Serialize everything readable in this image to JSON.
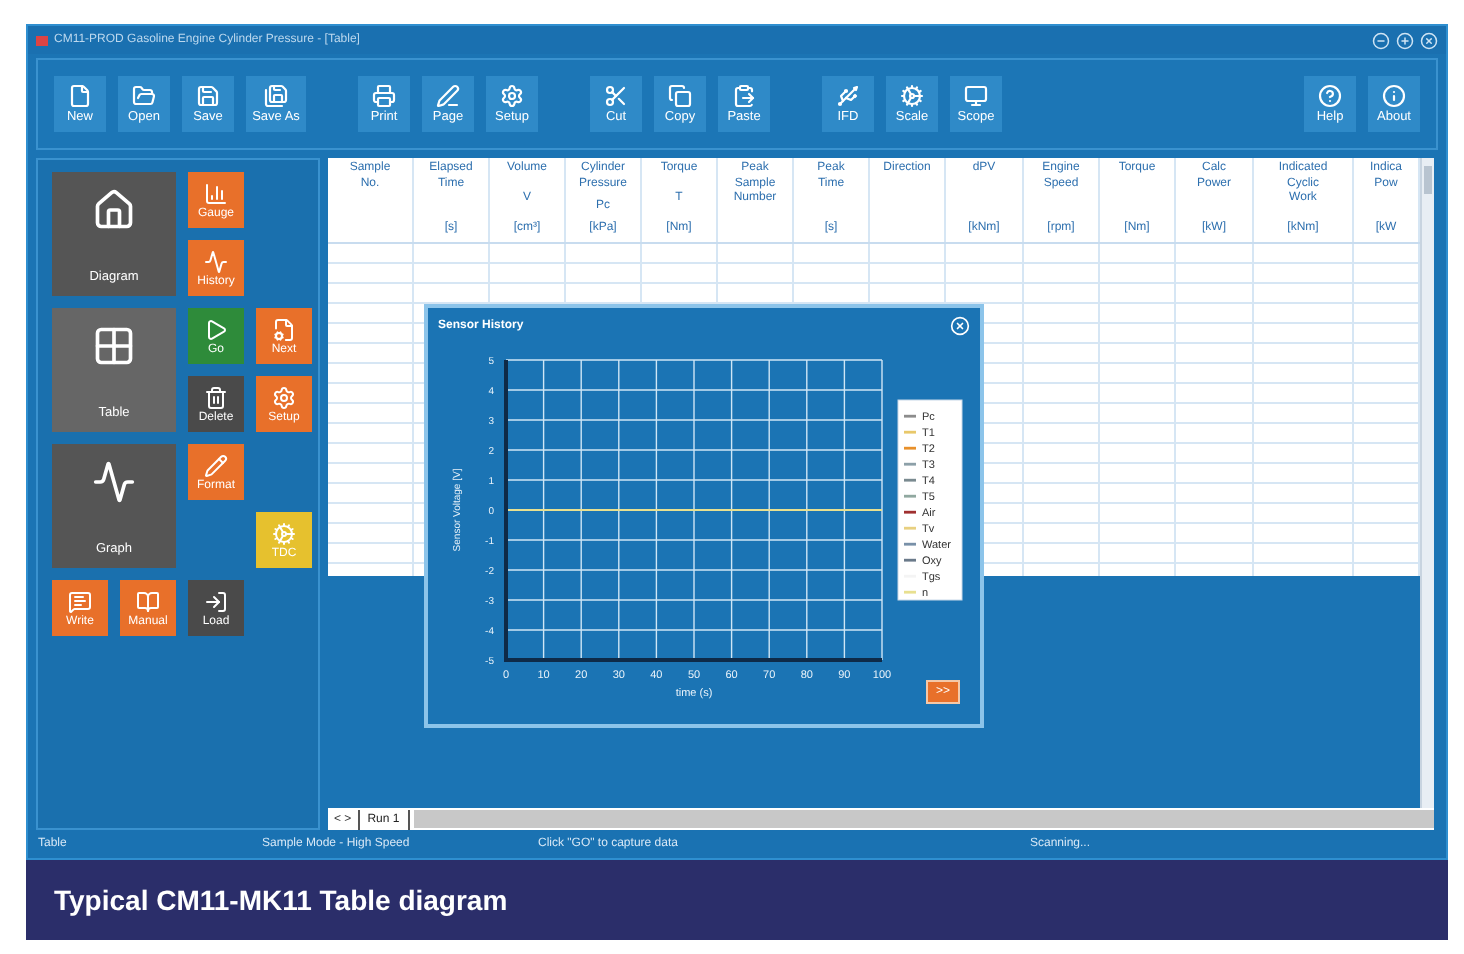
{
  "window": {
    "title": "CM11-PROD Gasoline Engine Cylinder Pressure - [Table]"
  },
  "toolbar": {
    "groups": [
      [
        "New",
        "Open",
        "Save",
        "Save As"
      ],
      [
        "Print",
        "Page",
        "Setup"
      ],
      [
        "Cut",
        "Copy",
        "Paste"
      ],
      [
        "IFD",
        "Scale",
        "Scope"
      ],
      [
        "Help",
        "About"
      ]
    ]
  },
  "sidebar": {
    "tiles": [
      {
        "label": "Diagram",
        "color": "#555555",
        "kind": "large"
      },
      {
        "label": "Gauge",
        "color": "#e8702a",
        "kind": "small"
      },
      {
        "label": "History",
        "color": "#e8702a",
        "kind": "small"
      },
      {
        "label": "Table",
        "color": "#666666",
        "kind": "large"
      },
      {
        "label": "Go",
        "color": "#2e8b3a",
        "kind": "small"
      },
      {
        "label": "Next",
        "color": "#e8702a",
        "kind": "small"
      },
      {
        "label": "Delete",
        "color": "#4a4a4a",
        "kind": "small"
      },
      {
        "label": "Setup",
        "color": "#e8702a",
        "kind": "small"
      },
      {
        "label": "Graph",
        "color": "#555555",
        "kind": "large"
      },
      {
        "label": "Format",
        "color": "#e8702a",
        "kind": "small"
      },
      {
        "label": "TDC",
        "color": "#e6c12e",
        "kind": "small"
      },
      {
        "label": "Write",
        "color": "#e8702a",
        "kind": "small"
      },
      {
        "label": "Manual",
        "color": "#e8702a",
        "kind": "small"
      },
      {
        "label": "Load",
        "color": "#4a4a4a",
        "kind": "small"
      }
    ]
  },
  "table": {
    "columns": [
      {
        "name": [
          "Sample",
          "No."
        ]
      },
      {
        "name": [
          "Elapsed",
          "Time"
        ],
        "unit": "[s]"
      },
      {
        "name": [
          "Volume"
        ],
        "symbol": "V",
        "unit": "[cm³]"
      },
      {
        "name": [
          "Cylinder",
          "Pressure"
        ],
        "symbol": "Pc",
        "unit": "[kPa]"
      },
      {
        "name": [
          "Torque"
        ],
        "symbol": "T",
        "unit": "[Nm]"
      },
      {
        "name": [
          "Peak",
          "Sample",
          "Number"
        ]
      },
      {
        "name": [
          "Peak",
          "Time"
        ],
        "unit": "[s]"
      },
      {
        "name": [
          "Direction"
        ]
      },
      {
        "name": [
          "dPV"
        ],
        "unit": "[kNm]"
      },
      {
        "name": [
          "Engine",
          "Speed"
        ],
        "unit": "[rpm]"
      },
      {
        "name": [
          "Torque"
        ],
        "unit": "[Nm]"
      },
      {
        "name": [
          "Calc",
          "Power"
        ],
        "unit": "[kW]"
      },
      {
        "name": [
          "Indicated",
          "Cyclic",
          "Work"
        ],
        "unit": "[kNm]"
      },
      {
        "name": [
          "Indica",
          "Pow"
        ],
        "unit": "[kW"
      }
    ]
  },
  "dialog": {
    "title": "Sensor History",
    "next_button": ">>",
    "plot": {
      "xlabel": "time (s)",
      "ylabel": "Sensor Voltage [V]",
      "xticks": [
        "0",
        "10",
        "20",
        "30",
        "40",
        "50",
        "60",
        "70",
        "80",
        "90",
        "100"
      ],
      "yticks": [
        "5",
        "4",
        "3",
        "2",
        "1",
        "0",
        "-1",
        "-2",
        "-3",
        "-4",
        "-5"
      ],
      "legend": [
        {
          "name": "Pc",
          "color": "#8c8c8c"
        },
        {
          "name": "T1",
          "color": "#e8c86a"
        },
        {
          "name": "T2",
          "color": "#e8902a"
        },
        {
          "name": "T3",
          "color": "#8ca0a8"
        },
        {
          "name": "T4",
          "color": "#7a8a90"
        },
        {
          "name": "T5",
          "color": "#90a8a0"
        },
        {
          "name": "Air",
          "color": "#a03030"
        },
        {
          "name": "Tv",
          "color": "#e8d080"
        },
        {
          "name": "Water",
          "color": "#7890a8"
        },
        {
          "name": "Oxy",
          "color": "#6a7a8a"
        },
        {
          "name": "Tgs",
          "color": "#f4f4f4"
        },
        {
          "name": "n",
          "color": "#e8e090"
        }
      ]
    }
  },
  "sheet_nav": "< >",
  "sheet_tabs": [
    {
      "label": "Run 1",
      "selected": true
    }
  ],
  "status_bar": [
    "Table",
    "Sample Mode - High Speed",
    "Click \"GO\" to capture data",
    "Scanning..."
  ],
  "caption": "Typical CM11-MK11 Table diagram"
}
